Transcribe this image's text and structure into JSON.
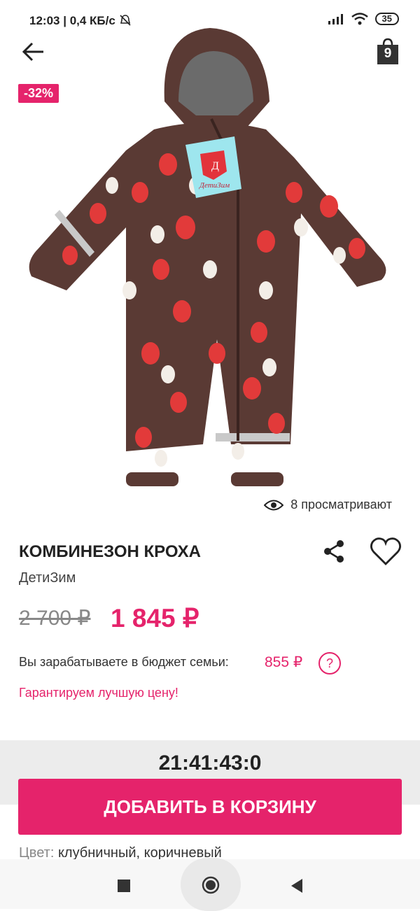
{
  "status": {
    "time": "12:03",
    "speed": "0,4 КБ/с",
    "battery": "35"
  },
  "header": {
    "cart_count": "9"
  },
  "product": {
    "discount": "-32%",
    "views": "8 просматривают",
    "title": "КОМБИНЕЗОН КРОХА",
    "brand": "ДетиЗим",
    "old_price": "2 700 ₽",
    "new_price": "1 845 ₽",
    "budget_label": "Вы зарабатываете в бюджет семьи:",
    "budget_value": "855 ₽",
    "guarantee": "Гарантируем лучшую цену!",
    "color_label": "Цвет:",
    "color_value": "клубничный, коричневый",
    "image_logo_text": "ДетиЗим",
    "image_logo_letter": "Д"
  },
  "timer": "21:41:43:0",
  "actions": {
    "add_to_cart": "ДОБАВИТЬ В КОРЗИНУ",
    "help_symbol": "?"
  },
  "icons": {
    "back": "arrow-left-icon",
    "cart": "shopping-bag-icon",
    "eye": "eye-icon",
    "share": "share-icon",
    "favorite": "heart-icon",
    "help": "question-icon"
  },
  "colors": {
    "accent": "#e5236b",
    "product_brown": "#5a3a34"
  }
}
